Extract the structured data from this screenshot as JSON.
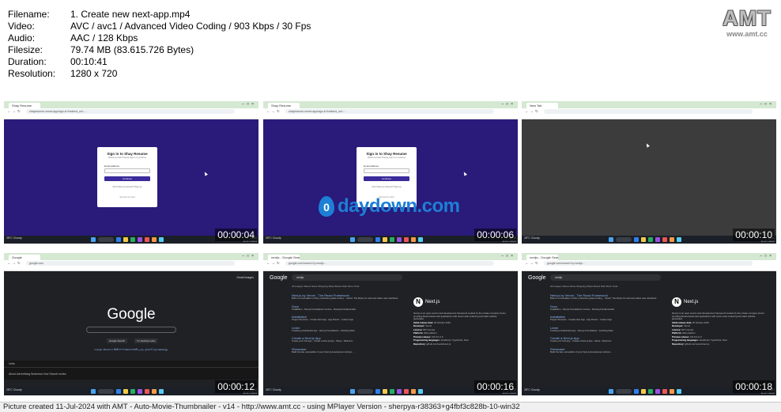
{
  "header": {
    "rows": [
      {
        "key": "Filename:",
        "value": "1. Create new next-app.mp4"
      },
      {
        "key": "Video:",
        "value": "AVC / avc1 / Advanced Video Coding / 903 Kbps / 30 Fps"
      },
      {
        "key": "Audio:",
        "value": "AAC / 128 Kbps"
      },
      {
        "key": "Filesize:",
        "value": "79.74 MB (83.615.726 Bytes)"
      },
      {
        "key": "Duration:",
        "value": "00:10:41"
      },
      {
        "key": "Resolution:",
        "value": "1280 x 720"
      }
    ]
  },
  "logo": {
    "text": "AMT",
    "url": "www.amt.cc"
  },
  "watermark": {
    "icon_text": "0",
    "text": "daydown.com"
  },
  "thumbnails": [
    {
      "timestamp": "00:00:04",
      "kind": "signin",
      "tab": "Shay Resume",
      "url": "shayresume.vercel.app/sign-in?redirect_url=...",
      "card_title": "Sign in to Shay Resume",
      "card_subtitle": "Welcome back! Please sign in to continue",
      "email_label": "Email address",
      "continue_label": "Continue",
      "signup_text": "Don't have an account? Sign up",
      "secured_text": "Secured by clerk"
    },
    {
      "timestamp": "00:00:06",
      "kind": "signin",
      "tab": "Shay Resume",
      "url": "shayresume.vercel.app/sign-in?redirect_url=...",
      "card_title": "Sign in to Shay Resume",
      "card_subtitle": "Welcome back! Please sign in to continue",
      "email_label": "Email address",
      "continue_label": "Continue",
      "signup_text": "Don't have an account? Sign up",
      "secured_text": "Secured by clerk"
    },
    {
      "timestamp": "00:00:10",
      "kind": "blank",
      "tab": "New Tab",
      "url": ""
    },
    {
      "timestamp": "00:00:12",
      "kind": "google",
      "tab": "Google",
      "url": "google.com",
      "logo": "Google",
      "btn1": "Google Search",
      "btn2": "I'm Feeling Lucky",
      "langs": "Google offered in: हिन्दी বাংলা తెలుగు मराठी தமிழ் ગુજરાતી ಕನ್ನಡ മലയാളം",
      "top_links": "Gmail   Images",
      "footer_country": "India",
      "footer_links": "About   Advertising   Business   How Search works"
    },
    {
      "timestamp": "00:00:16",
      "kind": "results",
      "tab": "nextjs - Google Search",
      "url": "google.com/search?q=nextjs...",
      "query": "nextjs",
      "tabs": "All   Images   Videos   News   Shopping   Maps   Books   Web   More      Tools",
      "results": [
        {
          "title": "Next.js by Vercel - The React Framework",
          "snippet": "Built on a foundation of fast, production-grade tooling ... React: The library for web and native user interfaces."
        },
        {
          "title": "Docs",
          "snippet": "Installation - Next.js Foundations Course - Routing Fundamentals"
        },
        {
          "title": "Installation",
          "snippet": "Project Structure - Create Next App - App Router - Custom App"
        },
        {
          "title": "Learn",
          "snippet": "Creating a dashboard app - Next.js Foundations - Fetching Data"
        },
        {
          "title": "Create a Next.js App",
          "snippet": "Create your first app - Create a Next.js App - Setup - Welcome"
        },
        {
          "title": "Showcase",
          "snippet": "Build the fast, accessible UI your Next.js development will pre..."
        }
      ],
      "kp": {
        "logo": "N",
        "title": "Next.js",
        "desc": "Next.js is an open-source web development framework created by the private company Vercel providing React-based web applications with server-side rendering and static website generation.",
        "fields": [
          {
            "k": "Initial release date:",
            "v": "25 October 2016"
          },
          {
            "k": "Developer:",
            "v": "Vercel"
          },
          {
            "k": "License:",
            "v": "MIT License"
          },
          {
            "k": "Platform:",
            "v": "Web platform"
          },
          {
            "k": "Preview release:",
            "v": "v15.0.0-rc.0"
          },
          {
            "k": "Programming languages:",
            "v": "JavaScript, TypeScript, Rust"
          },
          {
            "k": "Repository:",
            "v": "github.com/vercel/next.js"
          }
        ]
      }
    },
    {
      "timestamp": "00:00:18",
      "kind": "results",
      "tab": "nextjs - Google Search",
      "url": "google.com/search?q=nextjs...",
      "query": "nextjs",
      "tabs": "All   Images   Videos   News   Shopping   Maps   Books   Web   More      Tools",
      "results": [
        {
          "title": "Next.js by Vercel - The React Framework",
          "snippet": "Built on a foundation of fast, production-grade tooling ... React: The library for web and native user interfaces."
        },
        {
          "title": "Docs",
          "snippet": "Installation - Next.js Foundations Course - Routing Fundamentals"
        },
        {
          "title": "Installation",
          "snippet": "Project Structure - Create Next App - App Router - Custom App"
        },
        {
          "title": "Learn",
          "snippet": "Creating a dashboard app - Next.js Foundations - Fetching Data"
        },
        {
          "title": "Create a Next.js App",
          "snippet": "Create your first app - Create a Next.js App - Setup - Welcome"
        },
        {
          "title": "Showcase",
          "snippet": "Build the fast, accessible UI your Next.js development will pre..."
        }
      ],
      "kp": {
        "logo": "N",
        "title": "Next.js",
        "desc": "Next.js is an open-source web development framework created by the private company Vercel providing React-based web applications with server-side rendering and static website generation.",
        "fields": [
          {
            "k": "Initial release date:",
            "v": "25 October 2016"
          },
          {
            "k": "Developer:",
            "v": "Vercel"
          },
          {
            "k": "License:",
            "v": "MIT License"
          },
          {
            "k": "Platform:",
            "v": "Web platform"
          },
          {
            "k": "Preview release:",
            "v": "v15.0.0-rc.0"
          },
          {
            "k": "Programming languages:",
            "v": "JavaScript, TypeScript, Rust"
          },
          {
            "k": "Repository:",
            "v": "github.com/vercel/next.js"
          }
        ]
      }
    }
  ],
  "taskbar": {
    "weather": "28°C Cloudy",
    "clock_time": "12:42",
    "clock_date": "11-07-2024",
    "icon_colors": [
      "#2f80ed",
      "#f2c94c",
      "#27ae60",
      "#9b51e0",
      "#eb5757",
      "#f2994a",
      "#56ccf2"
    ]
  },
  "stamp": {
    "text": "Picture created 11-Jul-2024 with AMT - Auto-Movie-Thumbnailer - v14 - http://www.amt.cc - using MPlayer Version - sherpya-r38363+g4fbf3c828b-10-win32"
  }
}
